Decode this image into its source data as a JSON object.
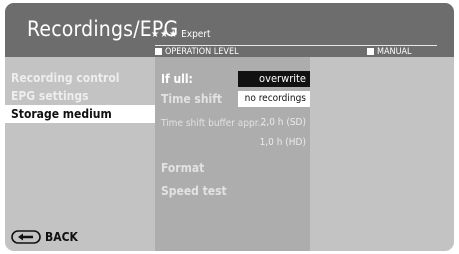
{
  "header": {
    "title": "Recordings/EPG",
    "level_stars": "★★★",
    "level_name": "Expert",
    "operation_level_label": "OPERATION LEVEL",
    "manual_label": "MANUAL"
  },
  "menu": {
    "items": [
      {
        "label": "Recording control",
        "selected": false
      },
      {
        "label": "EPG settings",
        "selected": false
      },
      {
        "label": "Storage medium",
        "selected": true
      }
    ]
  },
  "settings": {
    "if_full": {
      "label": "If ull:",
      "value": "overwrite"
    },
    "time_shift": {
      "label": "Time shift",
      "value": "no recordings"
    },
    "buffer": {
      "label": "Time shift buffer appr...",
      "value_sd": "2,0 h (SD)",
      "value_hd": "1,0 h (HD)"
    },
    "format": {
      "label": "Format"
    },
    "speed_test": {
      "label": "Speed test"
    }
  },
  "footer": {
    "back_label": "BACK",
    "back_icon": "back-arrow-icon"
  }
}
